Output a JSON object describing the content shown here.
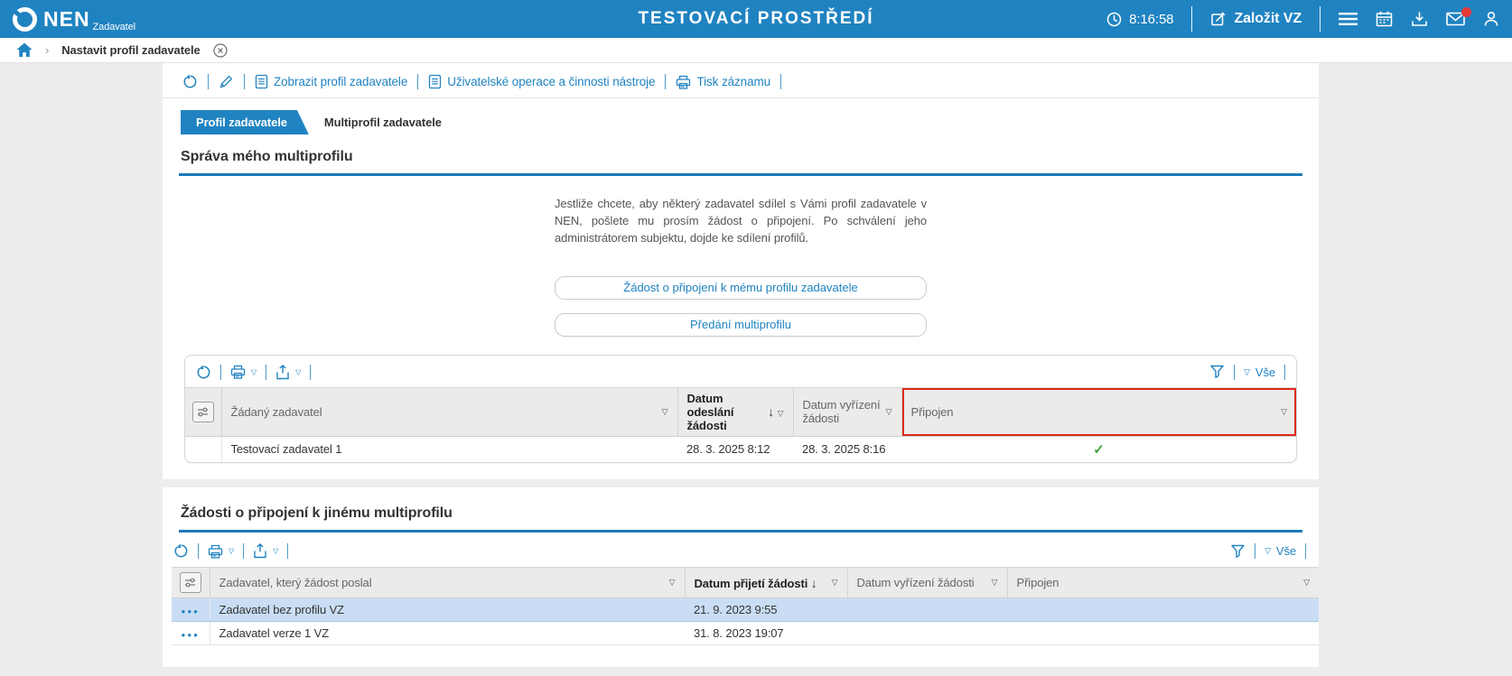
{
  "colors": {
    "header_bg": "#2083c1",
    "accent_blue": "#2083c1",
    "alert_red": "#e0281e",
    "notification_red": "#e53935",
    "success_green": "#3fa33c",
    "selected_row": "#c9def5",
    "underline_blue": "#1b7ab8"
  },
  "header": {
    "logo_title": "NEN",
    "logo_subtitle": "Zadavatel",
    "environment_title": "TESTOVACÍ PROSTŘEDÍ",
    "time": "8:16:58",
    "create_vz_label": "Založit VZ"
  },
  "breadcrumb": {
    "page_title": "Nastavit profil zadavatele"
  },
  "record_toolbar": {
    "links": [
      {
        "label": "Zobrazit profil zadavatele"
      },
      {
        "label": "Uživatelské operace a činnosti nástroje"
      },
      {
        "label": "Tisk záznamu"
      }
    ]
  },
  "tabs": [
    {
      "label": "Profil zadavatele"
    },
    {
      "label": "Multiprofil zadavatele"
    }
  ],
  "multiprofile_section": {
    "title": "Správa mého multiprofilu",
    "info_text": "Jestliže chcete, aby některý zadavatel sdílel s Vámi profil zadavatele v NEN, pošlete mu prosím žádost o připojení. Po schválení jeho administrátorem subjektu, dojde ke sdílení profilů.",
    "buttons": [
      {
        "label": "Žádost o připojení k mému profilu zadavatele"
      },
      {
        "label": "Předání multiprofilu"
      }
    ],
    "grid": {
      "filter_all_label": "Vše",
      "columns": [
        "Žádaný zadavatel",
        "Datum odeslání žádosti",
        "Datum vyřízení žádosti",
        "Připojen"
      ],
      "sorted_column": "Datum odeslání žádosti",
      "sort_direction": "desc",
      "rows": [
        {
          "zadavatel": "Testovací zadavatel 1",
          "datum_odeslani": "28. 3. 2025 8:12",
          "datum_vyrizeni": "28. 3. 2025 8:16",
          "pripojen": "✓"
        }
      ]
    }
  },
  "requests_section": {
    "title": "Žádosti o připojení k jinému multiprofilu",
    "grid": {
      "filter_all_label": "Vše",
      "columns": [
        "Zadavatel, který žádost poslal",
        "Datum přijetí žádosti",
        "Datum vyřízení žádosti",
        "Připojen"
      ],
      "sorted_column": "Datum přijetí žádosti",
      "sort_direction": "desc",
      "rows": [
        {
          "zadavatel": "Zadavatel bez profilu VZ",
          "datum_prijeti": "21. 9. 2023 9:55",
          "datum_vyrizeni": "",
          "pripojen": "",
          "selected": true
        },
        {
          "zadavatel": "Zadavatel verze 1 VZ",
          "datum_prijeti": "31. 8. 2023 19:07",
          "datum_vyrizeni": "",
          "pripojen": "",
          "selected": false
        }
      ]
    }
  }
}
